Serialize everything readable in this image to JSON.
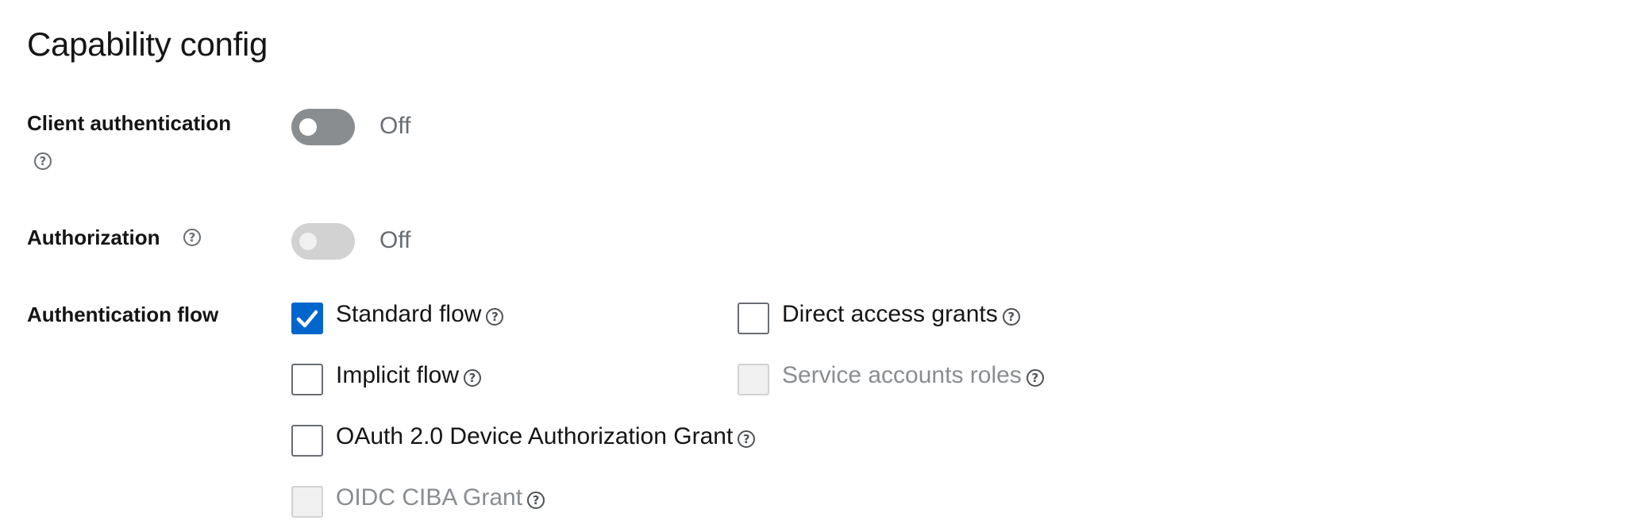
{
  "section": {
    "title": "Capability config"
  },
  "client_authentication": {
    "label": "Client authentication",
    "state": "Off",
    "enabled": false
  },
  "authorization": {
    "label": "Authorization",
    "state": "Off",
    "enabled": false,
    "disabled": true
  },
  "authentication_flow": {
    "label": "Authentication flow",
    "options": [
      {
        "label": "Standard flow",
        "checked": true,
        "disabled": false
      },
      {
        "label": "Direct access grants",
        "checked": false,
        "disabled": false
      },
      {
        "label": "Implicit flow",
        "checked": false,
        "disabled": false
      },
      {
        "label": "Service accounts roles",
        "checked": false,
        "disabled": true
      },
      {
        "label": "OAuth 2.0 Device Authorization Grant",
        "checked": false,
        "disabled": false
      },
      {
        "label": "OIDC CIBA Grant",
        "checked": false,
        "disabled": true
      }
    ]
  },
  "icons": {
    "help": "help-circle-icon",
    "check": "checkmark-icon"
  },
  "colors": {
    "accent": "#0066cc",
    "switch_off": "#8a8d90",
    "switch_disabled": "#d2d2d2",
    "muted_text": "#6a6e73"
  }
}
